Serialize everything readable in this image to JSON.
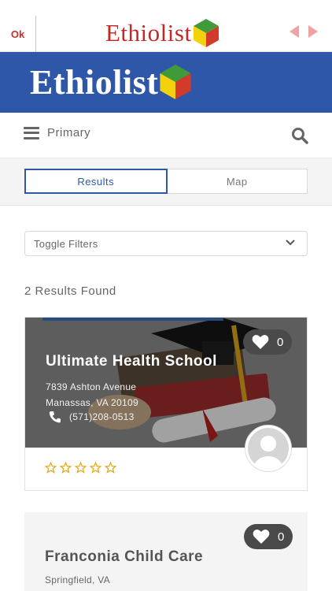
{
  "browser": {
    "ok_label": "Ok",
    "brand": "Ethiolist"
  },
  "banner": {
    "brand": "Ethiolist"
  },
  "nav": {
    "menu_label": "Primary"
  },
  "tabs": [
    {
      "label": "Results",
      "active": true
    },
    {
      "label": "Map",
      "active": false
    }
  ],
  "filters": {
    "label": "Toggle Filters"
  },
  "results": {
    "count_text": "2 Results Found",
    "listings": [
      {
        "title": "Ultimate Health School",
        "address_line1": "7839 Ashton Avenue",
        "address_line2": "Manassas, VA 20109",
        "phone": "(571)208-0513",
        "favorites": "0",
        "rating": 0
      },
      {
        "title": "Franconia Child Care",
        "city": "Springfield, VA",
        "favorites": "0"
      }
    ]
  },
  "colors": {
    "brand_blue": "#2e57a9",
    "brand_red": "#c62828",
    "star_gold": "#e8a712",
    "logo_yellow": "#f3d20c",
    "logo_green": "#3f9a3a",
    "logo_red": "#d23b2b"
  }
}
